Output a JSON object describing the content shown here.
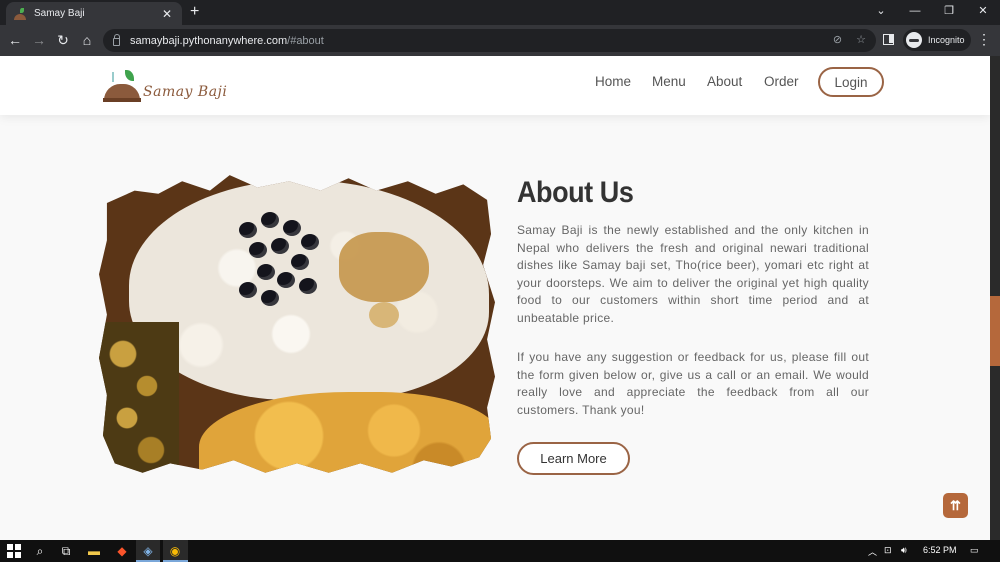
{
  "browser": {
    "tab_title": "Samay Baji",
    "tab_close": "✕",
    "new_tab": "+",
    "url_host": "samaybaji.pythonanywhere.com",
    "url_path": "/#about",
    "profile_label": "Incognito",
    "window_controls": [
      "—",
      "❐",
      "✕"
    ],
    "tabs_dropdown": "⌄"
  },
  "site": {
    "logo_text": "Samay Baji",
    "nav": [
      "Home",
      "Menu",
      "About",
      "Order"
    ],
    "login_label": "Login"
  },
  "about": {
    "title": "About Us",
    "paragraph1": "Samay Baji is the newly established and the only kitchen in Nepal who delivers the fresh and original newari traditional dishes like Samay baji set, Tho(rice beer), yomari etc right at your doorsteps. We aim to deliver the original yet high quality food to our customers within short time period and at unbeatable price.",
    "paragraph2": "If you have any suggestion or feedback for us, please fill out the form given below or, give us a call or an email. We would really love and appreciate the feedback from all our customers. Thank you!",
    "learn_more_label": "Learn More"
  },
  "back_to_top": "⇈",
  "taskbar": {
    "time": "6:52 PM"
  },
  "colors": {
    "accent": "#9a6445",
    "back_to_top": "#b5683b"
  }
}
